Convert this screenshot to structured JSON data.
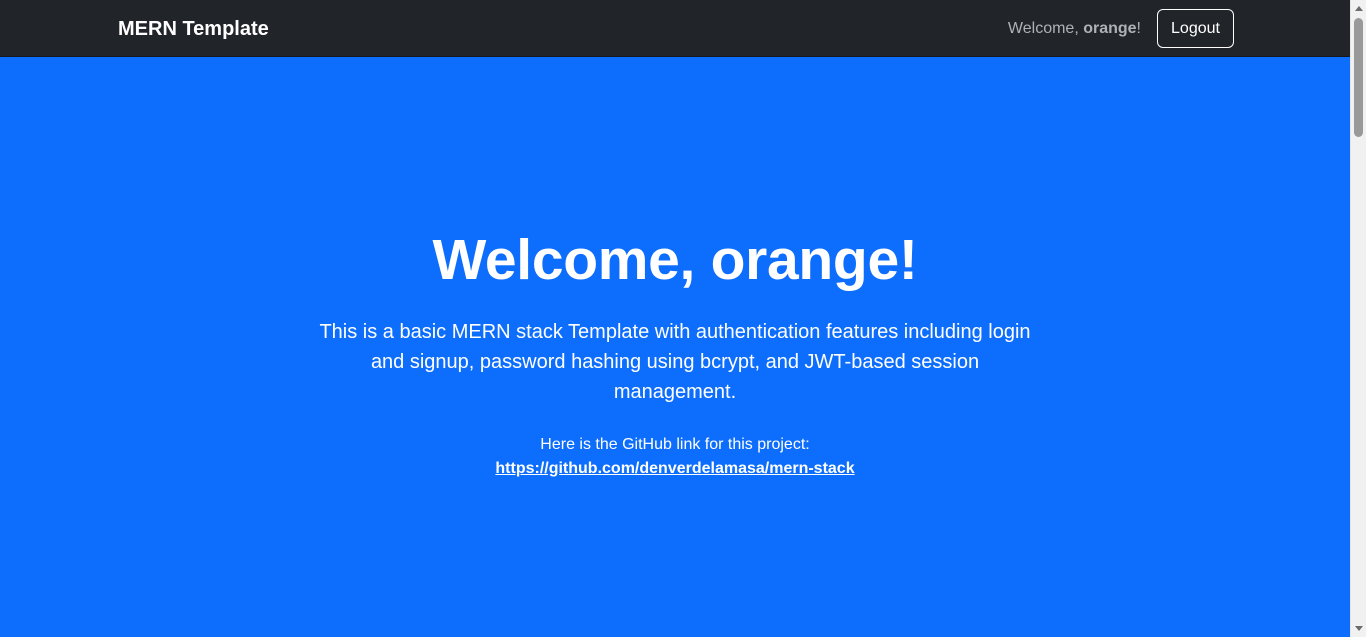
{
  "navbar": {
    "brand": "MERN Template",
    "welcome_prefix": "Welcome, ",
    "username": "orange",
    "welcome_suffix": "!",
    "logout_label": "Logout"
  },
  "hero": {
    "heading": "Welcome, orange!",
    "description": "This is a basic MERN stack Template with authentication features including login and signup, password hashing using bcrypt, and JWT-based session management.",
    "link_label": "Here is the GitHub link for this project:",
    "link_text": "https://github.com/denverdelamasa/mern-stack"
  },
  "colors": {
    "navbar_background": "#212529",
    "page_background": "#0d6efd",
    "text": "#ffffff",
    "muted_text": "#aeb2b7"
  }
}
